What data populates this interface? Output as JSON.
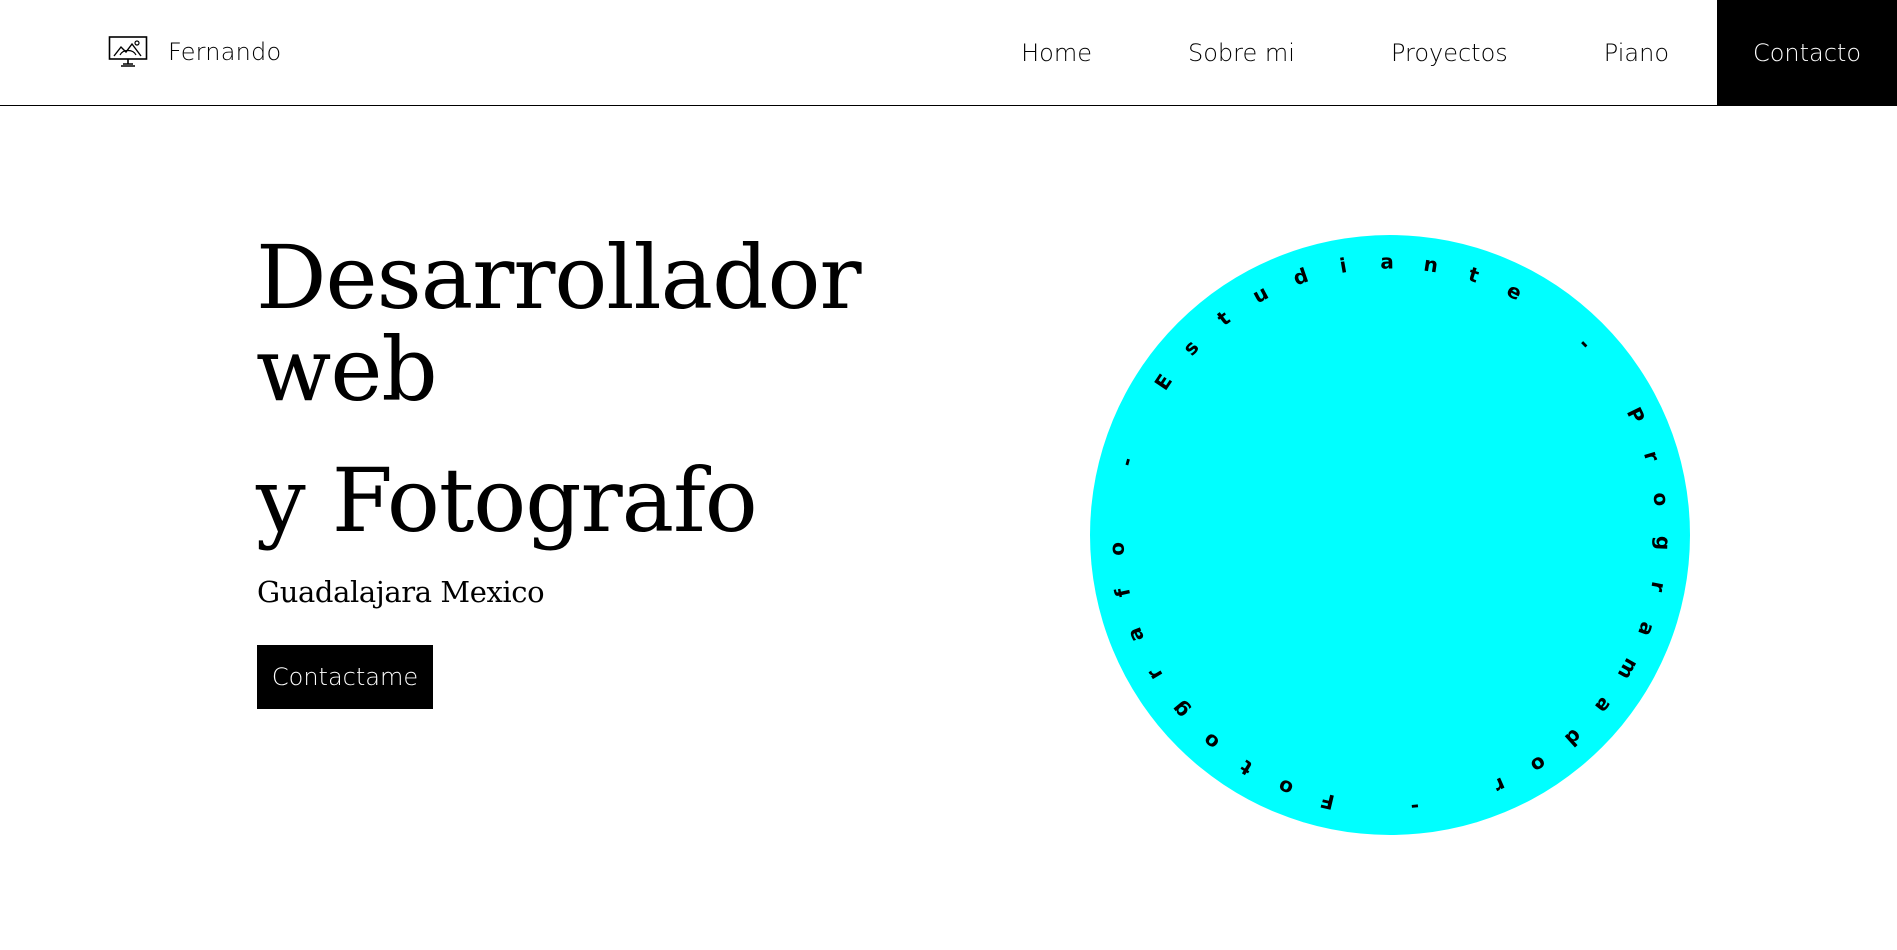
{
  "header": {
    "brand_name": "Fernando",
    "brand_icon": "monitor-landscape-icon",
    "nav": [
      {
        "label": "Home"
      },
      {
        "label": "Sobre mi"
      },
      {
        "label": "Proyectos"
      },
      {
        "label": "Piano"
      },
      {
        "label": "Contacto"
      }
    ]
  },
  "hero": {
    "title_line1": "Desarrollador",
    "title_line2": "web",
    "title_line3": "y Fotografo",
    "location": "Guadalajara Mexico",
    "cta_label": "Contactame"
  },
  "badge": {
    "circle_color": "#00ffff",
    "ring_text": "Estudiante - Programador - Fotografo - "
  }
}
